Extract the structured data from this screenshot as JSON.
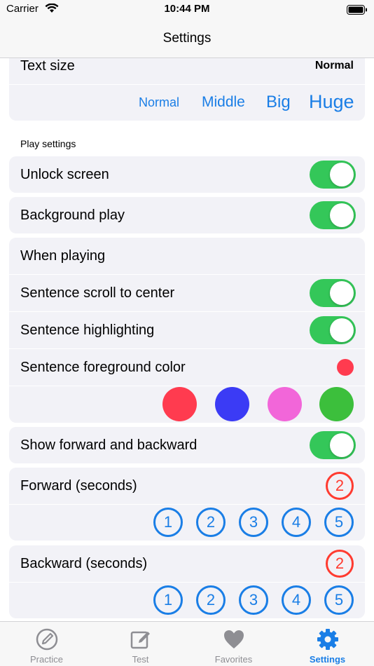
{
  "status_bar": {
    "carrier": "Carrier",
    "time": "10:44 PM"
  },
  "nav": {
    "title": "Settings"
  },
  "text_size": {
    "label": "Text size",
    "value": "Normal",
    "options": [
      "Normal",
      "Middle",
      "Big",
      "Huge"
    ]
  },
  "play_settings": {
    "header": "Play settings",
    "unlock_screen": {
      "label": "Unlock screen",
      "on": true
    },
    "background_play": {
      "label": "Background play",
      "on": true
    }
  },
  "when_playing": {
    "label": "When playing",
    "scroll_to_center": {
      "label": "Sentence scroll to center",
      "on": true
    },
    "highlighting": {
      "label": "Sentence highlighting",
      "on": true
    },
    "foreground_color": {
      "label": "Sentence foreground color",
      "selected_color": "#ff3b4f",
      "options": [
        "#ff3b4f",
        "#3b3bf5",
        "#f266d9",
        "#3cbf3c"
      ]
    }
  },
  "show_forward_backward": {
    "label": "Show forward and backward",
    "on": true
  },
  "forward": {
    "label": "Forward (seconds)",
    "selected": "2",
    "options": [
      "1",
      "2",
      "3",
      "4",
      "5"
    ]
  },
  "backward": {
    "label": "Backward (seconds)",
    "selected": "2",
    "options": [
      "1",
      "2",
      "3",
      "4",
      "5"
    ]
  },
  "tab_bar": {
    "tabs": [
      {
        "label": "Practice",
        "icon": "pencil-circle-icon",
        "active": false
      },
      {
        "label": "Test",
        "icon": "square-pencil-icon",
        "active": false
      },
      {
        "label": "Favorites",
        "icon": "heart-icon",
        "active": false
      },
      {
        "label": "Settings",
        "icon": "gear-icon",
        "active": true
      }
    ]
  },
  "colors": {
    "accent": "#1a7ee6",
    "toggle_on": "#34c759",
    "selected_red": "#ff3b30",
    "card_bg": "#f2f2f7"
  }
}
